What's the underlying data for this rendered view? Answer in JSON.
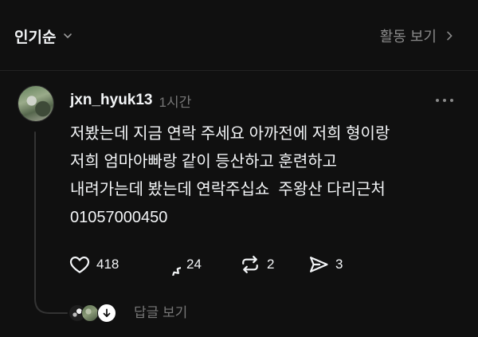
{
  "header": {
    "sort_label": "인기순",
    "activity_label": "활동 보기"
  },
  "post": {
    "username": "jxn_hyuk13",
    "time": "1시간",
    "body_lines": [
      "저봤는데 지금 연락 주세요 아까전에 저희 형이랑",
      "저희 엄마아빠랑 같이 등산하고 훈련하고",
      "내려가는데 봤는데 연락주십쇼  주왕산 다리근처",
      "01057000450"
    ],
    "actions": {
      "likes": "418",
      "replies": "24",
      "reposts": "2",
      "shares": "3"
    }
  },
  "replies_preview": {
    "label": "답글 보기"
  },
  "icons": {
    "sort_toggle": "chevron-down-icon",
    "activity_link": "chevron-right-icon",
    "more": "more-options-icon",
    "like": "heart-icon",
    "reply": "comment-icon",
    "repost": "repost-icon",
    "share": "send-icon",
    "expand_replies": "arrow-down-icon"
  },
  "colors": {
    "background": "#101010",
    "text": "#f3f5f7",
    "secondary_text": "#8a8a8a",
    "thread_line": "#333333"
  }
}
